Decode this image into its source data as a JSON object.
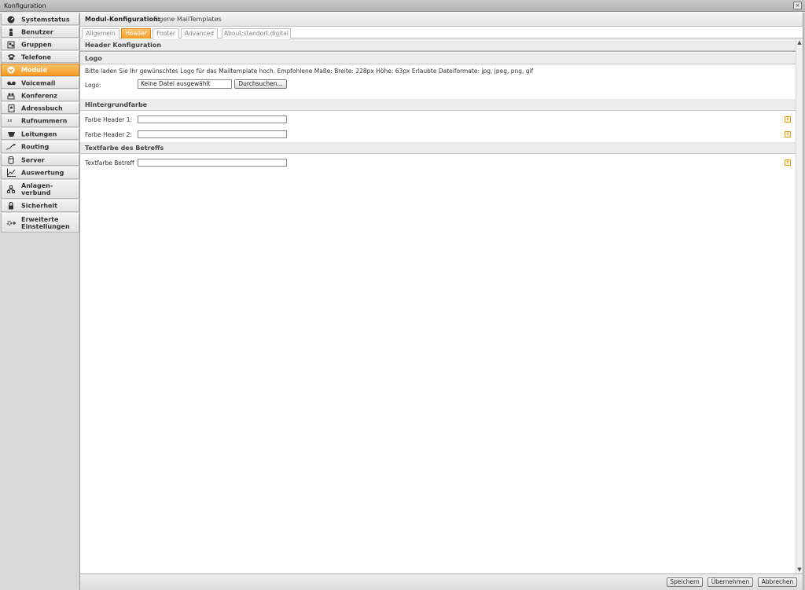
{
  "window": {
    "title": "Konfiguration",
    "close_label": "×"
  },
  "sidebar": {
    "items": [
      {
        "label": "Systemstatus",
        "icon": "dashboard-icon"
      },
      {
        "label": "Benutzer",
        "icon": "user-icon"
      },
      {
        "label": "Gruppen",
        "icon": "group-icon"
      },
      {
        "label": "Telefone",
        "icon": "phone-icon"
      },
      {
        "label": "Module",
        "icon": "module-icon",
        "active": true
      },
      {
        "label": "Voicemail",
        "icon": "voicemail-icon"
      },
      {
        "label": "Konferenz",
        "icon": "conference-icon"
      },
      {
        "label": "Adressbuch",
        "icon": "addressbook-icon"
      },
      {
        "label": "Rufnummern",
        "icon": "numbers-icon"
      },
      {
        "label": "Leitungen",
        "icon": "lines-icon"
      },
      {
        "label": "Routing",
        "icon": "routing-icon"
      },
      {
        "label": "Server",
        "icon": "server-icon"
      },
      {
        "label": "Auswertung",
        "icon": "chart-icon"
      },
      {
        "label": "Anlagen-\nverbund",
        "icon": "network-icon"
      },
      {
        "label": "Sicherheit",
        "icon": "lock-icon"
      },
      {
        "label": "Erweiterte\nEinstellungen",
        "icon": "settings-plus-icon"
      }
    ]
  },
  "main": {
    "module_label": "Modul-Konfiguration:",
    "module_value": "Eigene MailTemplates",
    "tabs": [
      {
        "label": "Allgemein"
      },
      {
        "label": "Header",
        "active": true
      },
      {
        "label": "Footer"
      },
      {
        "label": "Advanced"
      },
      {
        "label": "About:standort.digital"
      }
    ],
    "header_config_title": "Header Konfiguration",
    "logo": {
      "section_title": "Logo",
      "description": "Bitte laden Sie Ihr gewünschtes Logo für das Mailtemplate hoch. Empfohlene Maße: Breite: 228px Höhe: 63px Erlaubte Dateiformate: jpg, jpeg, png, gif",
      "field_label": "Logo:",
      "file_status": "Keine Datei ausgewählt",
      "browse_label": "Durchsuchen..."
    },
    "background": {
      "section_title": "Hintergrundfarbe",
      "header1_label": "Farbe Header 1:",
      "header1_value": "",
      "header2_label": "Farbe Header 2:",
      "header2_value": ""
    },
    "subject_color": {
      "section_title": "Textfarbe des Betreffs",
      "field_label": "Textfarbe Betreff",
      "field_value": ""
    }
  },
  "footer": {
    "save_label": "Speichern",
    "apply_label": "Übernehmen",
    "cancel_label": "Abbrechen"
  },
  "colors": {
    "accent": "#f39a26",
    "sidebar_bg": "#d8d8d8",
    "section_bg": "#ececec"
  }
}
